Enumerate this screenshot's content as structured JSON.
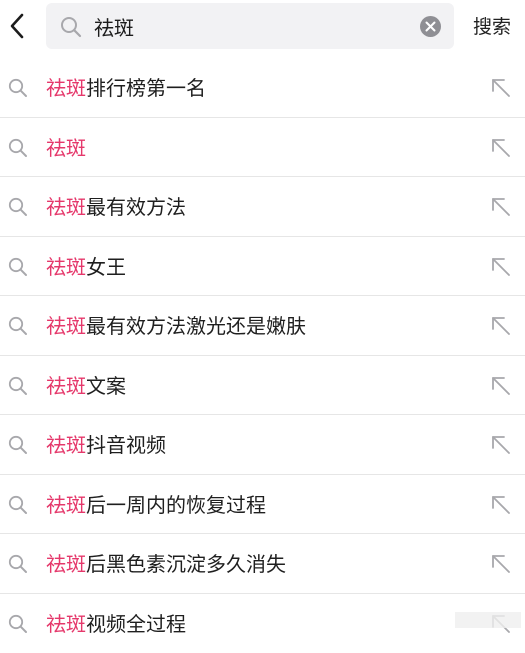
{
  "header": {
    "back_icon": "chevron-left-icon",
    "search": {
      "value": "祛斑",
      "placeholder": ""
    },
    "clear_icon": "clear-icon",
    "submit_label": "搜索"
  },
  "suggestions": [
    {
      "highlight": "祛斑",
      "rest": "排行榜第一名"
    },
    {
      "highlight": "祛斑",
      "rest": ""
    },
    {
      "highlight": "祛斑",
      "rest": "最有效方法"
    },
    {
      "highlight": "祛斑",
      "rest": "女王"
    },
    {
      "highlight": "祛斑",
      "rest": "最有效方法激光还是嫩肤"
    },
    {
      "highlight": "祛斑",
      "rest": "文案"
    },
    {
      "highlight": "祛斑",
      "rest": "抖音视频"
    },
    {
      "highlight": "祛斑",
      "rest": "后一周内的恢复过程"
    },
    {
      "highlight": "祛斑",
      "rest": "后黑色素沉淀多久消失"
    },
    {
      "highlight": "祛斑",
      "rest": "视频全过程"
    }
  ],
  "colors": {
    "highlight": "#e5386b",
    "icon": "#a8a8ac",
    "search_bg": "#f2f2f4"
  }
}
